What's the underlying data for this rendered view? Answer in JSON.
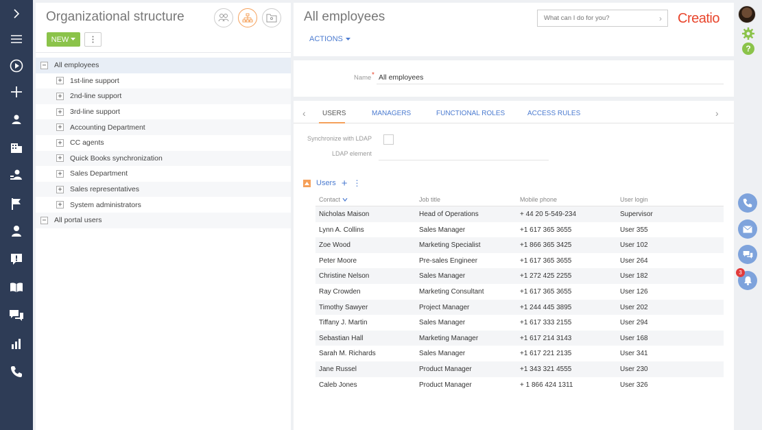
{
  "rail": {
    "items": [
      "chevron-right-icon",
      "menu-icon",
      "play-icon",
      "plus-icon",
      "contact-icon",
      "building-icon",
      "users-icon",
      "flag-icon",
      "person-icon",
      "alert-icon",
      "book-icon",
      "chat-icon",
      "chart-icon",
      "phone-icon"
    ]
  },
  "left_panel": {
    "title": "Organizational structure",
    "new_label": "NEW",
    "tree": [
      {
        "label": "All employees",
        "level": 0,
        "toggle": "−",
        "selected": true
      },
      {
        "label": "1st-line support",
        "level": 1,
        "toggle": "+"
      },
      {
        "label": "2nd-line support",
        "level": 1,
        "toggle": "+"
      },
      {
        "label": "3rd-line support",
        "level": 1,
        "toggle": "+"
      },
      {
        "label": "Accounting Department",
        "level": 1,
        "toggle": "+"
      },
      {
        "label": "CC agents",
        "level": 1,
        "toggle": "+"
      },
      {
        "label": "Quick Books synchronization",
        "level": 1,
        "toggle": "+"
      },
      {
        "label": "Sales Department",
        "level": 1,
        "toggle": "+"
      },
      {
        "label": "Sales representatives",
        "level": 1,
        "toggle": "+"
      },
      {
        "label": "System administrators",
        "level": 1,
        "toggle": "+"
      },
      {
        "label": "All portal users",
        "level": 0,
        "toggle": "−"
      }
    ]
  },
  "header": {
    "title": "All employees",
    "actions_label": "ACTIONS",
    "search_placeholder": "What can I do for you?",
    "logo": "Creatio"
  },
  "name_field": {
    "label": "Name",
    "required_mark": "*",
    "value": "All employees"
  },
  "tabs": [
    "USERS",
    "MANAGERS",
    "FUNCTIONAL ROLES",
    "ACCESS RULES"
  ],
  "ldap": {
    "sync_label": "Synchronize with LDAP",
    "element_label": "LDAP element"
  },
  "users_detail": {
    "title": "Users",
    "columns": [
      "Contact",
      "Job title",
      "Mobile phone",
      "User login"
    ],
    "rows": [
      [
        "Nicholas Maison",
        "Head of Operations",
        "+ 44 20 5-549-234",
        "Supervisor"
      ],
      [
        "Lynn A. Collins",
        "Sales Manager",
        "+1 617 365 3655",
        "User 355"
      ],
      [
        "Zoe Wood",
        "Marketing Specialist",
        "+1 866 365 3425",
        "User 102"
      ],
      [
        "Peter Moore",
        "Pre-sales Engineer",
        "+1 617 365 3655",
        "User 264"
      ],
      [
        "Christine Nelson",
        "Sales Manager",
        "+1 272 425 2255",
        "User 182"
      ],
      [
        "Ray  Crowden",
        "Marketing Consultant",
        "+1 617 365 3655",
        "User 126"
      ],
      [
        "Timothy Sawyer",
        "Project Manager",
        "+1 244 445 3895",
        "User 202"
      ],
      [
        "Tiffany J. Martin",
        "Sales Manager",
        "+1 617 333 2155",
        "User 294"
      ],
      [
        "Sebastian Hall",
        "Marketing Manager",
        "+1 617 214 3143",
        "User 168"
      ],
      [
        "Sarah M. Richards",
        "Sales Manager",
        "+1 617 221 2135",
        "User 341"
      ],
      [
        "Jane Russel",
        "Product Manager",
        "+1 343 321 4555",
        "User 230"
      ],
      [
        "Caleb Jones",
        "Product Manager",
        "+ 1 866 424 1311",
        "User 326"
      ]
    ]
  },
  "notifications": {
    "count": "3"
  },
  "colors": {
    "accent": "#4b7bd0",
    "brand": "#e8452c",
    "new_button": "#8bc34a",
    "rail": "#2e3c56"
  }
}
